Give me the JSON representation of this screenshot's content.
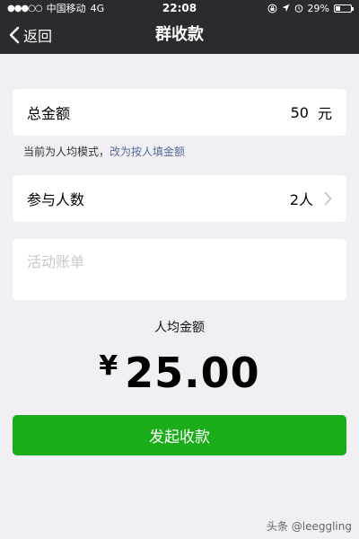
{
  "status_bar": {
    "signal_dots": "●●●○○",
    "carrier": "中国移动",
    "network": "4G",
    "time": "22:08",
    "battery_percent": "29%",
    "battery_level": 0.29
  },
  "navbar": {
    "back_label": "返回",
    "title": "群收款"
  },
  "total": {
    "label": "总金额",
    "value": "50",
    "unit": "元"
  },
  "mode_hint": {
    "text": "当前为人均模式，",
    "link": "改为按人填金额"
  },
  "participants": {
    "label": "参与人数",
    "value": "2人"
  },
  "memo": {
    "placeholder": "活动账单",
    "value": ""
  },
  "per_person": {
    "label": "人均金额",
    "currency": "¥",
    "amount": "25.00"
  },
  "submit_label": "发起收款",
  "watermark": "头条 @leeggling",
  "colors": {
    "nav_bg": "#2b2b2f",
    "page_bg": "#efeff4",
    "primary": "#1aad19",
    "link": "#576b95"
  }
}
